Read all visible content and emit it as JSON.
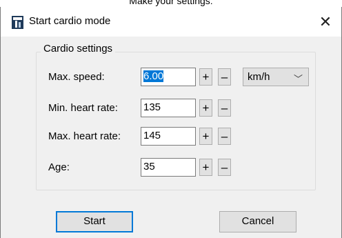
{
  "caption": "Make your settings:",
  "window": {
    "title": "Start cardio mode",
    "close_glyph": "✕"
  },
  "group": {
    "label": "Cardio settings"
  },
  "fields": {
    "max_speed": {
      "label": "Max. speed:",
      "value": "6.00"
    },
    "min_heart_rate": {
      "label": "Min. heart rate:",
      "value": "135"
    },
    "max_heart_rate": {
      "label": "Max. heart rate:",
      "value": "145"
    },
    "age": {
      "label": "Age:",
      "value": "35"
    }
  },
  "stepper": {
    "plus": "+",
    "minus": "–"
  },
  "unit": {
    "selected": "km/h"
  },
  "buttons": {
    "start": "Start",
    "cancel": "Cancel"
  },
  "colors": {
    "accent": "#0078d7",
    "dialog_bg": "#f0f0f0",
    "button_bg": "#e1e1e1"
  }
}
